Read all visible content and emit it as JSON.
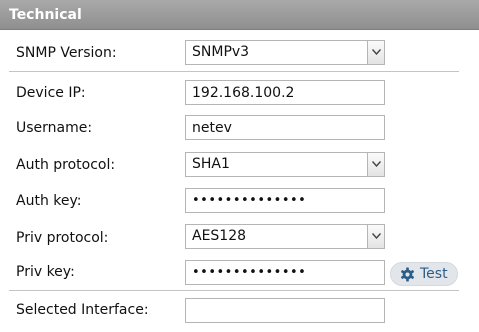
{
  "header": {
    "title": "Technical"
  },
  "form": {
    "snmp_version": {
      "label": "SNMP Version:",
      "value": "SNMPv3"
    },
    "device_ip": {
      "label": "Device IP:",
      "value": "192.168.100.2"
    },
    "username": {
      "label": "Username:",
      "value": "netev"
    },
    "auth_protocol": {
      "label": "Auth protocol:",
      "value": "SHA1"
    },
    "auth_key": {
      "label": "Auth key:",
      "value": "••••••••••••••"
    },
    "priv_protocol": {
      "label": "Priv protocol:",
      "value": "AES128"
    },
    "priv_key": {
      "label": "Priv key:",
      "value": "••••••••••••••"
    },
    "selected_interface": {
      "label": "Selected Interface:",
      "value": ""
    }
  },
  "test_button": {
    "label": "Test",
    "icon": "gear-icon",
    "color": "#2c5d86"
  },
  "colors": {
    "header_bg": "#9a9a9a",
    "border": "#b5b5b5",
    "divider": "#c4c4c4"
  }
}
